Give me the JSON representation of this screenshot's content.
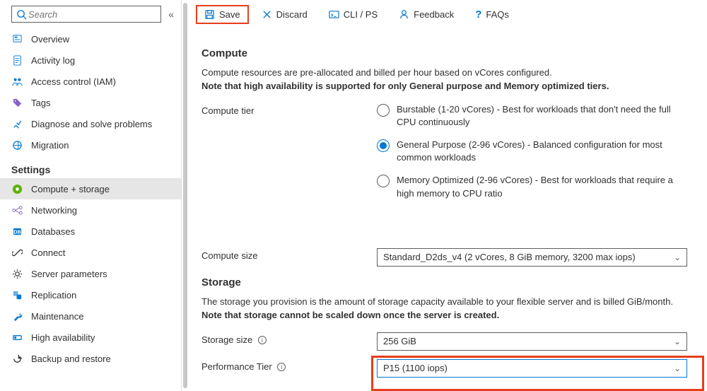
{
  "search": {
    "placeholder": "Search"
  },
  "sidebar": {
    "items": [
      {
        "label": "Overview"
      },
      {
        "label": "Activity log"
      },
      {
        "label": "Access control (IAM)"
      },
      {
        "label": "Tags"
      },
      {
        "label": "Diagnose and solve problems"
      },
      {
        "label": "Migration"
      }
    ],
    "section_label": "Settings",
    "settings": [
      {
        "label": "Compute + storage"
      },
      {
        "label": "Networking"
      },
      {
        "label": "Databases"
      },
      {
        "label": "Connect"
      },
      {
        "label": "Server parameters"
      },
      {
        "label": "Replication"
      },
      {
        "label": "Maintenance"
      },
      {
        "label": "High availability"
      },
      {
        "label": "Backup and restore"
      }
    ]
  },
  "toolbar": {
    "save": "Save",
    "discard": "Discard",
    "cli": "CLI / PS",
    "feedback": "Feedback",
    "faqs": "FAQs"
  },
  "compute": {
    "title": "Compute",
    "desc": "Compute resources are pre-allocated and billed per hour based on vCores configured.",
    "desc_bold": "Note that high availability is supported for only General purpose and Memory optimized tiers.",
    "tier_label": "Compute tier",
    "tiers": [
      "Burstable (1-20 vCores) - Best for workloads that don't need the full CPU continuously",
      "General Purpose (2-96 vCores) - Balanced configuration for most common workloads",
      "Memory Optimized (2-96 vCores) - Best for workloads that require a high memory to CPU ratio"
    ],
    "size_label": "Compute size",
    "size_value": "Standard_D2ds_v4 (2 vCores, 8 GiB memory, 3200 max iops)"
  },
  "storage": {
    "title": "Storage",
    "desc": "The storage you provision is the amount of storage capacity available to your flexible server and is billed GiB/month.",
    "desc_bold": "Note that storage cannot be scaled down once the server is created.",
    "size_label": "Storage size",
    "size_value": "256 GiB",
    "perf_label": "Performance Tier",
    "perf_value": "P15 (1100 iops)"
  }
}
